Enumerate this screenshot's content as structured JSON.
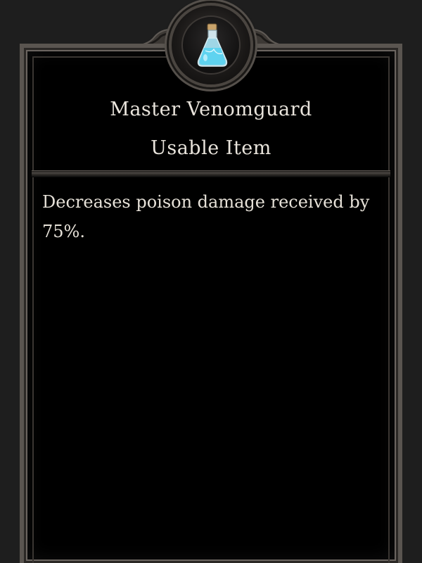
{
  "item": {
    "name": "Master Venomguard",
    "type": "Usable Item",
    "description": "Decreases poison damage received by 75%.",
    "icon": "potion-flask-icon"
  },
  "colors": {
    "background": "#000000",
    "frame": "#5a5550",
    "text": "#e9e4dc",
    "potion_liquid": "#5fd3f0"
  }
}
